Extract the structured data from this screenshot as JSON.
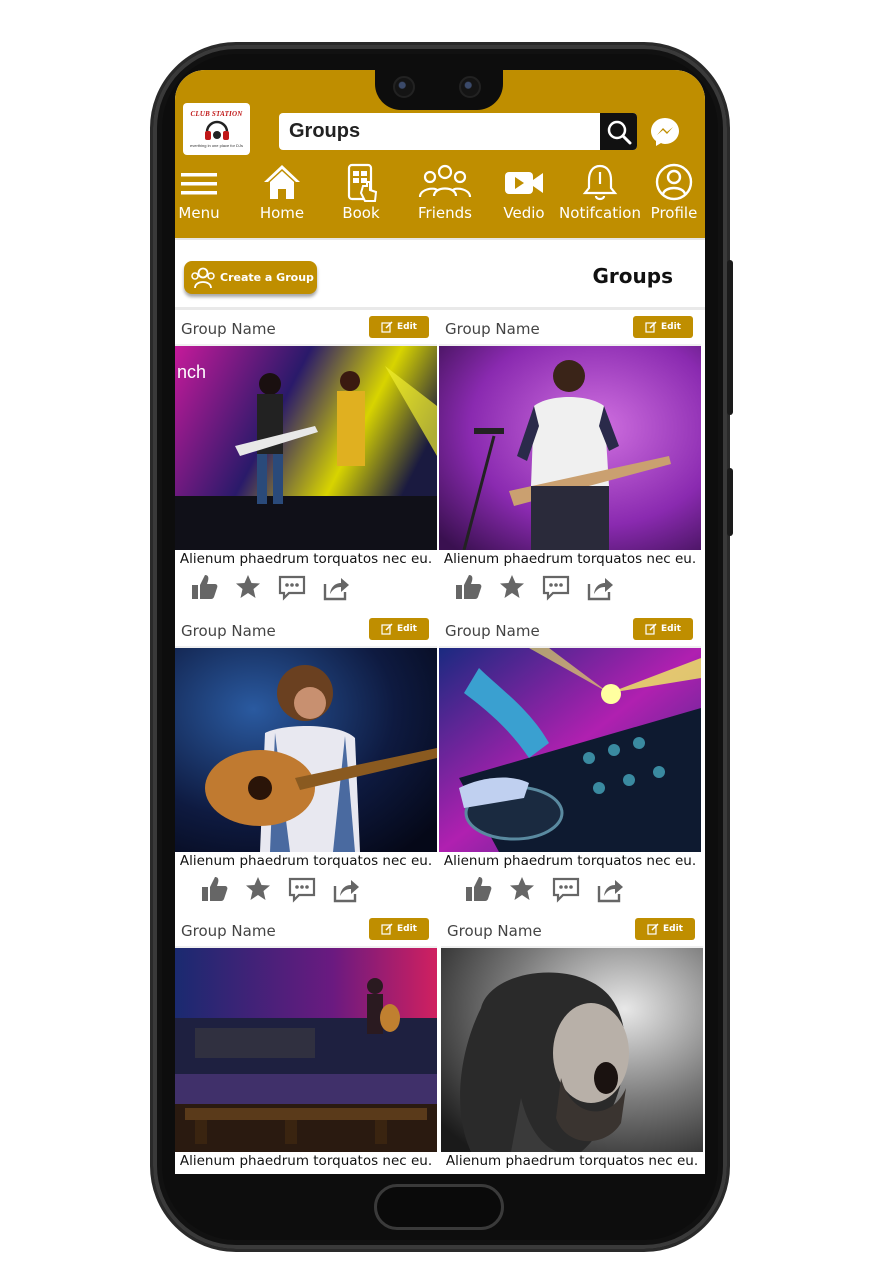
{
  "app": {
    "logo_text": "CLUB STATION",
    "logo_sub": "everthing in one place for DJs",
    "search_value": "Groups"
  },
  "nav": [
    {
      "label": "Menu",
      "icon": "menu-icon"
    },
    {
      "label": "Home",
      "icon": "home-icon"
    },
    {
      "label": "Book",
      "icon": "book-icon"
    },
    {
      "label": "Friends",
      "icon": "friends-icon"
    },
    {
      "label": "Vedio",
      "icon": "video-icon"
    },
    {
      "label": "Notifcation",
      "icon": "bell-icon"
    },
    {
      "label": "Profile",
      "icon": "profile-icon"
    }
  ],
  "page": {
    "create_label": "Create a Group",
    "heading": "Groups"
  },
  "cards": [
    {
      "name": "Group Name",
      "edit": "Edit",
      "caption": "Alienum phaedrum torquatos nec eu.",
      "image": "band-concert"
    },
    {
      "name": "Group Name",
      "edit": "Edit",
      "caption": "Alienum phaedrum torquatos nec eu.",
      "image": "guitarist-purple"
    },
    {
      "name": "Group Name",
      "edit": "Edit",
      "caption": "Alienum phaedrum torquatos nec eu.",
      "image": "acoustic-guitarist"
    },
    {
      "name": "Group Name",
      "edit": "Edit",
      "caption": "Alienum phaedrum torquatos nec eu.",
      "image": "dj-mixer"
    },
    {
      "name": "Group Name",
      "edit": "Edit",
      "caption": "Alienum phaedrum torquatos nec eu.",
      "image": "stage-collage"
    },
    {
      "name": "Group Name",
      "edit": "Edit",
      "caption": "Alienum phaedrum torquatos nec eu.",
      "image": "singer-bw"
    }
  ],
  "colors": {
    "accent": "#bf8e00",
    "icon_gray": "#666666"
  }
}
